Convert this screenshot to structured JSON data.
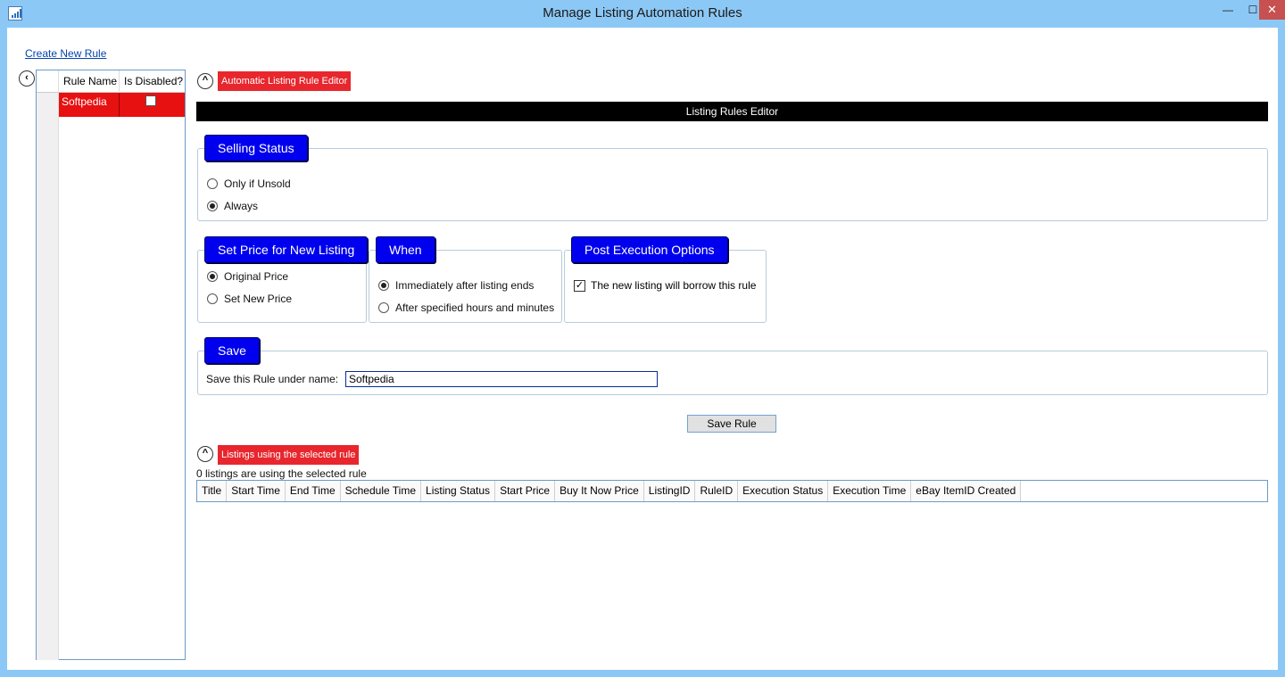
{
  "window": {
    "title": "Manage Listing Automation Rules",
    "minimize_glyph": "—",
    "maximize_glyph": "☐",
    "close_glyph": "✕"
  },
  "sidebar": {
    "create_link": "Create New Rule",
    "collapse_glyph": "‹",
    "grid": {
      "columns": [
        "Rule Name",
        "Is Disabled?"
      ],
      "rows": [
        {
          "name": "Softpedia",
          "disabled": false
        }
      ]
    }
  },
  "editor": {
    "collapse_glyph": "^",
    "tag": "Automatic Listing Rule Editor",
    "bar_title": "Listing Rules Editor",
    "selling_status": {
      "title": "Selling Status",
      "options": [
        "Only if Unsold",
        "Always"
      ],
      "selected": "Always"
    },
    "set_price": {
      "title": "Set Price for New Listing",
      "options": [
        "Original Price",
        "Set New Price"
      ],
      "selected": "Original Price"
    },
    "when": {
      "title": "When",
      "options": [
        "Immediately after listing ends",
        "After specified hours and minutes"
      ],
      "selected": "Immediately after listing ends"
    },
    "post_exec": {
      "title": "Post Execution Options",
      "checkbox_label": "The new listing will borrow this rule",
      "checked": true
    },
    "save": {
      "title": "Save",
      "name_label": "Save this Rule under name:",
      "name_value": "Softpedia",
      "button": "Save Rule"
    }
  },
  "listings": {
    "collapse_glyph": "^",
    "tag": "Listings using the selected rule",
    "count_text": "0 listings are using the selected rule",
    "columns": [
      "Title",
      "Start Time",
      "End Time",
      "Schedule Time",
      "Listing Status",
      "Start Price",
      "Buy It Now Price",
      "ListingID",
      "RuleID",
      "Execution Status",
      "Execution Time",
      "eBay ItemID Created"
    ]
  },
  "colors": {
    "title_bar": "#8cc8f5",
    "group_title_bg": "#0000ee",
    "tag_red": "#e8262d",
    "selected_row": "#e81111",
    "close_button": "#c75050"
  }
}
